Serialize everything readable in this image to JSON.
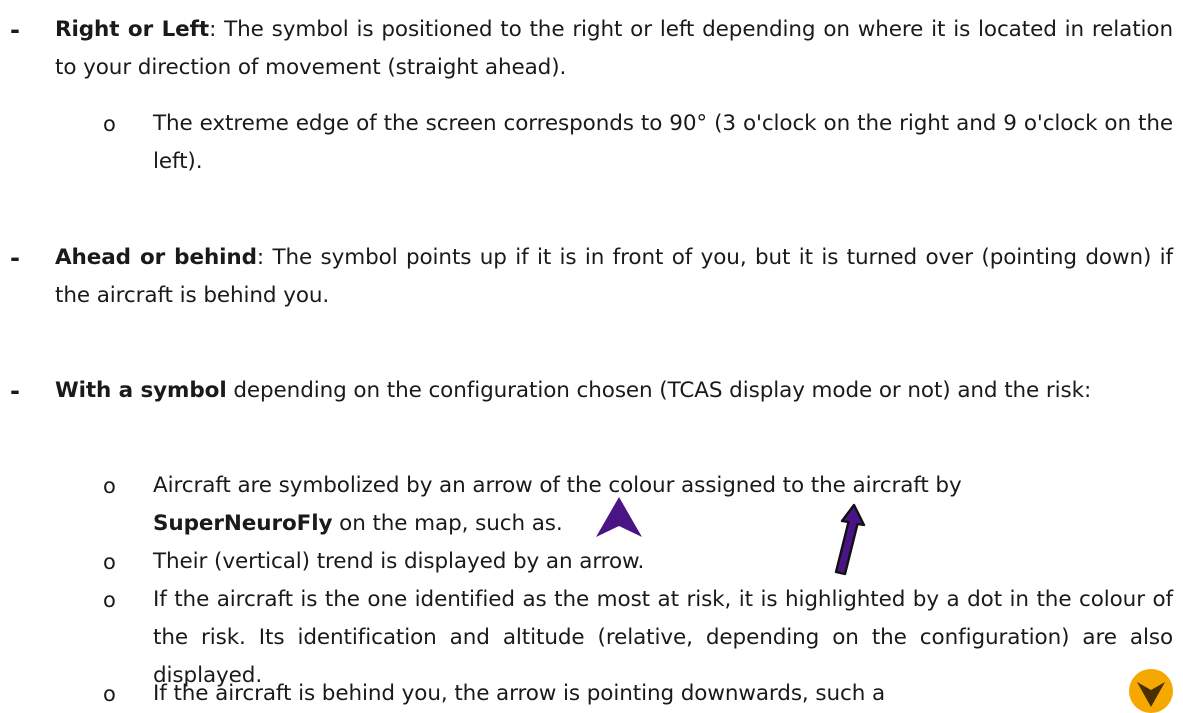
{
  "sections": [
    {
      "bullet": "-",
      "lead": "Right or Left",
      "sep": ": ",
      "rest": "The symbol is positioned to the right or left depending on where it is located in relation to your direction of movement (straight ahead).",
      "subs": [
        "The extreme edge of the screen corresponds to 90° (3 o'clock on the right and 9 o'clock on the left)."
      ]
    },
    {
      "bullet": "-",
      "lead": "Ahead or behind",
      "sep": ": ",
      "rest": "The symbol points up if it is in front of you, but it is turned over (pointing down) if the aircraft is behind you."
    },
    {
      "bullet": "-",
      "lead": "With a symbol",
      "sep": " ",
      "rest": "depending on the configuration chosen (TCAS display mode or not) and the risk:",
      "subs": [
        "Aircraft are symbolized by an arrow of the colour assigned to the aircraft by",
        "SuperNeuroFly",
        " on the map, such as.",
        "Their (vertical) trend is displayed by an arrow.",
        "If the aircraft is the one identified as the most at risk, it is highlighted by a dot in the colour of the risk. Its identification and altitude (relative, depending on the configuration) are also displayed.",
        "If the aircraft is behind you, the arrow is pointing downwards, such a"
      ]
    }
  ],
  "sub_bullet": "o",
  "icons": {
    "aircraft_arrow": "purple-triangle-icon",
    "trend_arrow": "purple-trend-arrow-icon",
    "behind_symbol": "orange-circle-down-chevron-icon"
  },
  "colors": {
    "aircraft": "#4b1486",
    "risk": "#f5a800"
  }
}
